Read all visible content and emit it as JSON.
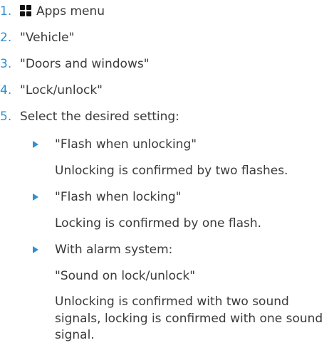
{
  "steps": [
    {
      "number": "1.",
      "icon": "apps-menu-grid-icon",
      "text": "Apps menu"
    },
    {
      "number": "2.",
      "text": "\"Vehicle\""
    },
    {
      "number": "3.",
      "text": "\"Doors and windows\""
    },
    {
      "number": "4.",
      "text": "\"Lock/unlock\""
    },
    {
      "number": "5.",
      "text": "Select the desired setting:"
    }
  ],
  "options": [
    {
      "label": "\"Flash when unlocking\"",
      "description": "Unlocking is confirmed by two flashes."
    },
    {
      "label": "\"Flash when locking\"",
      "description": "Locking is confirmed by one flash."
    },
    {
      "label": "With alarm system:",
      "setting": "\"Sound on lock/unlock\"",
      "description": "Unlocking is confirmed with two sound signals, locking is confirmed with one sound signal."
    }
  ],
  "colors": {
    "accent": "#2f8fd1",
    "text": "#3a3a3a",
    "icon": "#111111"
  }
}
